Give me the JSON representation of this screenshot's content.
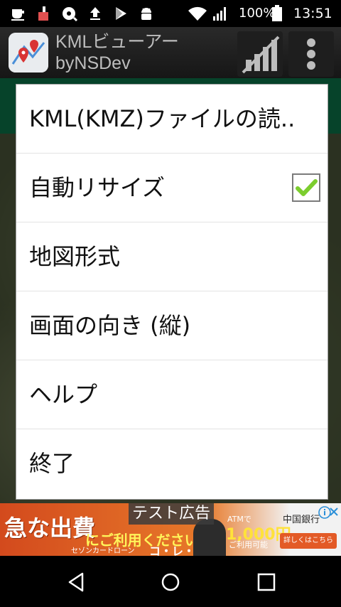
{
  "status_bar": {
    "battery_percent": "100%",
    "time": "13:51",
    "icons": [
      "notification-cup-icon",
      "broom-icon",
      "disc-icon",
      "upload-icon",
      "play-store-icon",
      "android-icon",
      "wifi-icon",
      "signal-icon",
      "battery-icon"
    ]
  },
  "action_bar": {
    "title_line1": "KMLビューアー",
    "title_line2": "byNSDev",
    "icons": [
      "app-logo-icon",
      "signal-chart-icon",
      "overflow-menu-icon"
    ]
  },
  "menu": {
    "items": [
      {
        "label": "KML(KMZ)ファイルの読.."
      },
      {
        "label": "自動リサイズ",
        "checked": true
      },
      {
        "label": "地図形式"
      },
      {
        "label": "画面の向き (縦)"
      },
      {
        "label": "ヘルプ"
      },
      {
        "label": "終了"
      }
    ]
  },
  "ad": {
    "tag": "テスト広告",
    "headline": "急な出費",
    "subline": "にご利用ください",
    "small": "セゾンカードローン",
    "brand": "コ・レ・カ",
    "atm": "ATMで",
    "amount": "1,000円",
    "free": "ご利用可能",
    "bank": "中国銀行",
    "cta": "詳しくはこちら"
  },
  "nav_bar": {
    "icons": [
      "back-icon",
      "home-icon",
      "recents-icon"
    ]
  }
}
